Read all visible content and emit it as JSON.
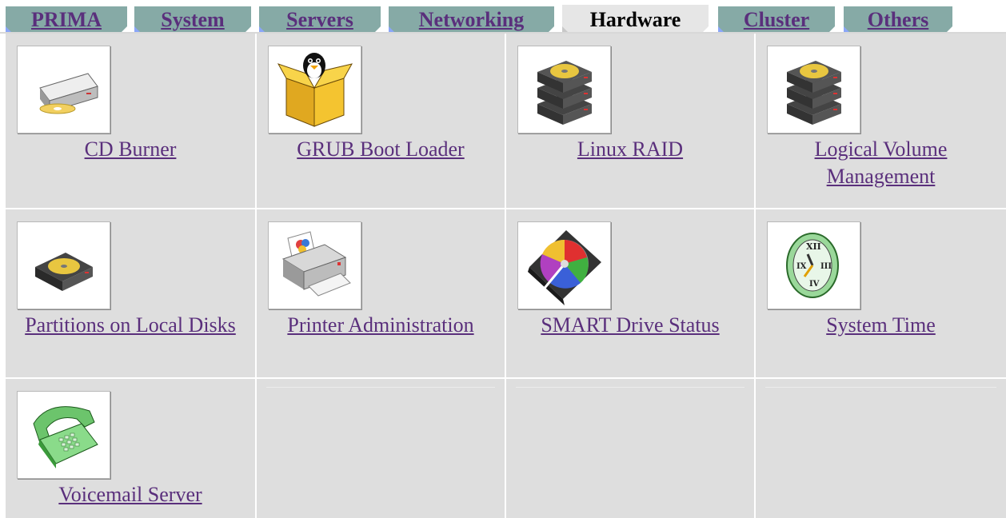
{
  "tabs": [
    {
      "label": "PRIMA",
      "active": false
    },
    {
      "label": "System",
      "active": false
    },
    {
      "label": "Servers",
      "active": false
    },
    {
      "label": "Networking",
      "active": false
    },
    {
      "label": "Hardware",
      "active": true
    },
    {
      "label": "Cluster",
      "active": false
    },
    {
      "label": "Others",
      "active": false
    }
  ],
  "modules": [
    {
      "label": "CD Burner",
      "icon": "cd-burner-icon"
    },
    {
      "label": "GRUB Boot Loader",
      "icon": "linux-box-icon"
    },
    {
      "label": "Linux RAID",
      "icon": "raid-disks-icon"
    },
    {
      "label": "Logical Volume Management",
      "icon": "lvm-disks-icon"
    },
    {
      "label": "Partitions on Local Disks",
      "icon": "hard-disk-icon"
    },
    {
      "label": "Printer Administration",
      "icon": "printer-icon"
    },
    {
      "label": "SMART Drive Status",
      "icon": "smart-drive-icon"
    },
    {
      "label": "System Time",
      "icon": "clock-icon"
    },
    {
      "label": "Voicemail Server",
      "icon": "telephone-icon"
    }
  ],
  "colors": {
    "tab_inactive": "#86aaa6",
    "tab_active": "#e6e6e6",
    "link": "#5a2f7c",
    "cell_bg": "#dedede"
  }
}
